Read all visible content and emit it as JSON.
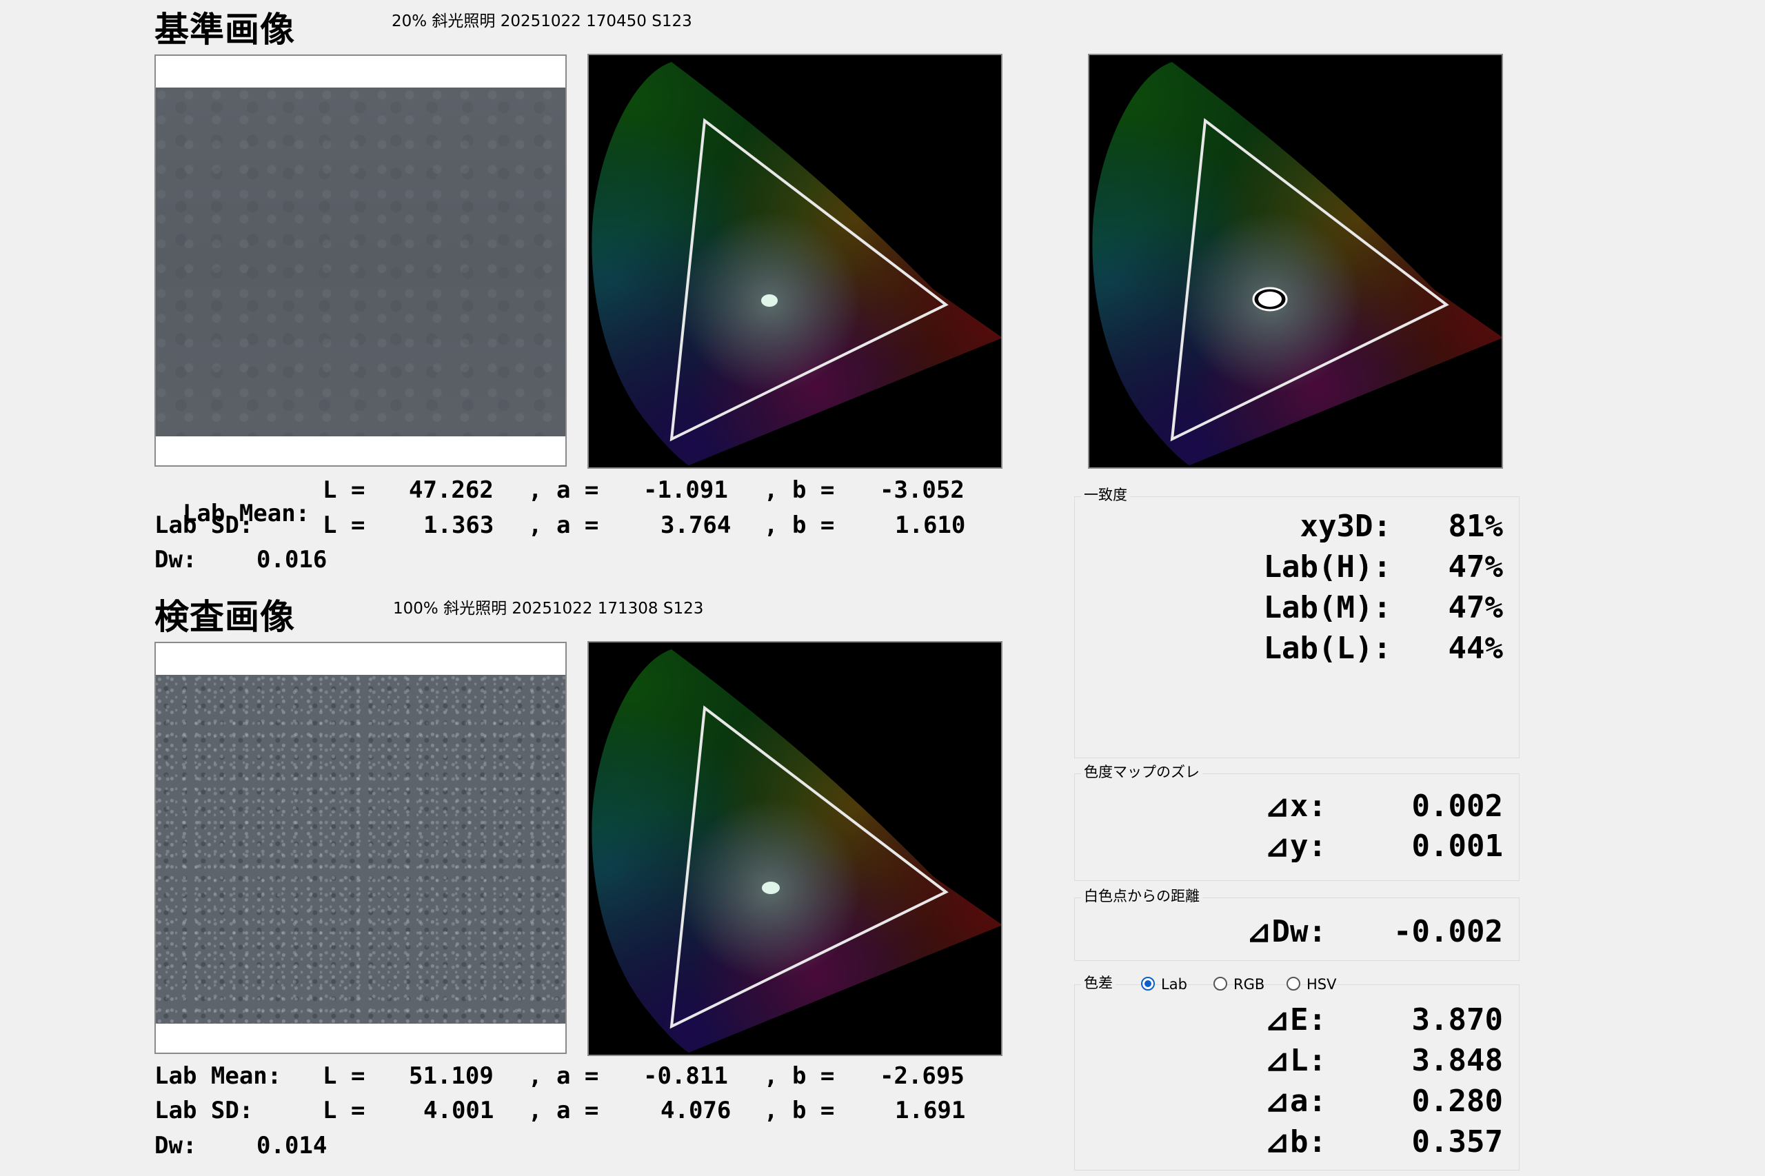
{
  "reference": {
    "title": "基準画像",
    "caption": "20%  斜光照明  20251022  170450  S123",
    "lab_mean": {
      "label": "Lab Mean:",
      "L": "47.262",
      "a": "-1.091",
      "b": "-3.052"
    },
    "lab_sd": {
      "label": "Lab SD:",
      "L": "1.363",
      "a": "3.764",
      "b": "1.610"
    },
    "dw": {
      "label": "Dw:",
      "value": "0.016"
    }
  },
  "test": {
    "title": "検査画像",
    "caption": "100%  斜光照明  20251022  171308  S123",
    "lab_mean": {
      "label": "Lab Mean:",
      "L": "51.109",
      "a": "-0.811",
      "b": "-2.695"
    },
    "lab_sd": {
      "label": "Lab SD:",
      "L": "4.001",
      "a": "4.076",
      "b": "1.691"
    },
    "dw": {
      "label": "Dw:",
      "value": "0.014"
    }
  },
  "stat_labels": {
    "L": "L =",
    "a": ", a =",
    "b": ", b ="
  },
  "match": {
    "group_label": "一致度",
    "rows": [
      {
        "label": "xy3D:",
        "value": "81%"
      },
      {
        "label": "Lab(H):",
        "value": "47%"
      },
      {
        "label": "Lab(M):",
        "value": "47%"
      },
      {
        "label": "Lab(L):",
        "value": "44%"
      }
    ]
  },
  "shift": {
    "group_label": "色度マップのズレ",
    "rows": [
      {
        "label": "⊿x:",
        "value": "0.002"
      },
      {
        "label": "⊿y:",
        "value": "0.001"
      }
    ]
  },
  "white_dist": {
    "group_label": "白色点からの距離",
    "rows": [
      {
        "label": "⊿Dw:",
        "value": "-0.002"
      }
    ]
  },
  "color_diff": {
    "group_label": "色差",
    "options": [
      {
        "label": "Lab",
        "checked": true
      },
      {
        "label": "RGB",
        "checked": false
      },
      {
        "label": "HSV",
        "checked": false
      }
    ],
    "rows": [
      {
        "label": "⊿E:",
        "value": "3.870"
      },
      {
        "label": "⊿L:",
        "value": "3.848"
      },
      {
        "label": "⊿a:",
        "value": "0.280"
      },
      {
        "label": "⊿b:",
        "value": "0.357"
      }
    ]
  },
  "colors": {
    "background": "#f0f0f0",
    "radio_accent": "#0a5fc8",
    "swatch_ref": "#5a5f66",
    "swatch_test": "#5e646c"
  }
}
